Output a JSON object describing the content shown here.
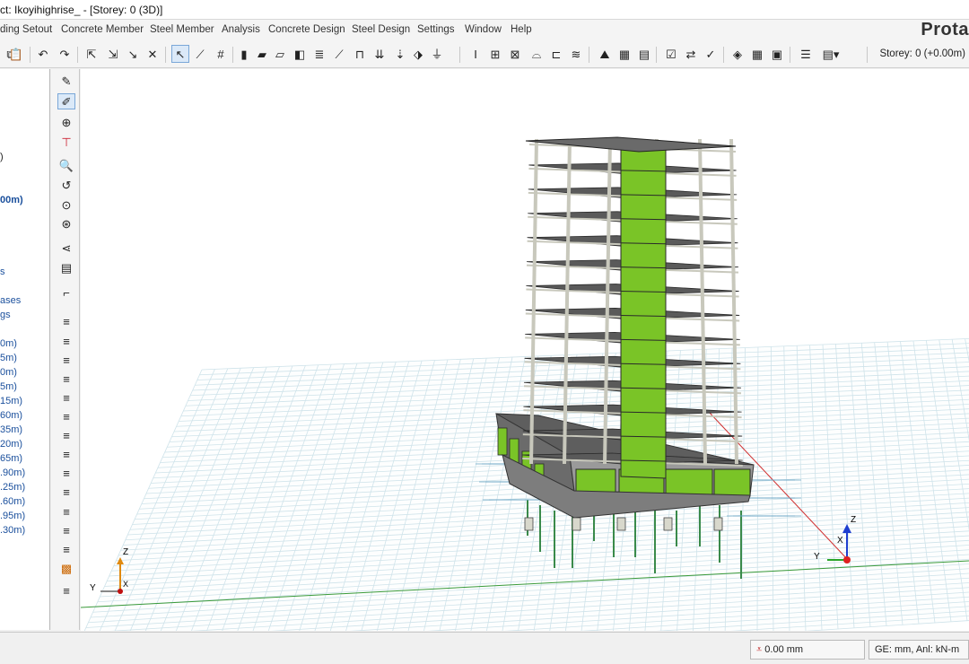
{
  "window": {
    "title": "ct: Ikoyihighrise_ - [Storey: 0 (3D)]",
    "brand": "Prota"
  },
  "menu": [
    "ding Setout",
    "Concrete Member",
    "Steel Member",
    "Analysis",
    "Concrete Design",
    "Steel Design",
    "Settings",
    "Window",
    "Help"
  ],
  "toolbar": {
    "storey": "Storey: 0 (+0.00m)"
  },
  "left_panel": {
    "items": [
      ")",
      "00m)",
      "s",
      "ases",
      "gs",
      "0m)",
      "5m)",
      "0m)",
      "5m)",
      "15m)",
      "60m)",
      "35m)",
      "20m)",
      "65m)",
      ".90m)",
      ".25m)",
      ".60m)",
      ".95m)",
      ".30m)"
    ]
  },
  "viewport": {
    "axes_global": {
      "z": "Z",
      "x": "X",
      "y": "Y"
    },
    "axes_local": {
      "z": "Z",
      "x": "X",
      "y": "Y"
    },
    "colors": {
      "core": "#7ac427",
      "slab": "#5a5a5a",
      "column": "#c8c8bc",
      "pile": "#3a8a4a",
      "grid": "#cfe3ea"
    }
  },
  "status": {
    "elevation": "0.00 mm",
    "units": "GE: mm,  Anl: kN-m"
  }
}
